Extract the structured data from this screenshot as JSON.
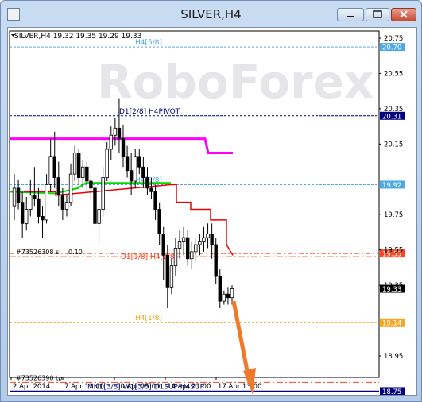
{
  "window": {
    "title": "SILVER,H4",
    "buttons": [
      "minimize",
      "maximize",
      "close"
    ]
  },
  "chart_header": "SILVER,H4  19.32 19.35 19.29 19.33",
  "watermark": "RoboForex",
  "colors": {
    "murrey_resistance": "#4fa9e8",
    "murrey_support": "#f5a623",
    "pivot_magenta": "#ff00ff",
    "green_line": "#00dd00",
    "red_line": "#ee0000",
    "navy_line": "#000080",
    "trade_line": "#ff4422",
    "arrow": "#f07a2a",
    "candles": "#000000",
    "grid_label_dark": "#000000"
  },
  "chart_data": {
    "type": "candlestick",
    "symbol": "SILVER",
    "timeframe": "H4",
    "ylim": [
      18.72,
      20.8
    ],
    "y_ticks": [
      20.75,
      20.55,
      20.35,
      20.15,
      19.75,
      19.55,
      19.35,
      18.95
    ],
    "x_tick_labels": [
      "2 Apr 2014",
      "7 Apr 13:00",
      "10 Apr 05:00",
      "14 Apr 21:00",
      "17 Apr 13:00"
    ],
    "current_price": 19.33,
    "levels": [
      {
        "label": "H4[5/8]",
        "value": 20.7,
        "style": "dashed",
        "color": "#4fa9e8",
        "tag": "20.70"
      },
      {
        "label": "D1[2/8] H4PIVOT",
        "value": 20.31,
        "style": "dashed",
        "color": "#000080",
        "tag": "20.31"
      },
      {
        "label": "H4[3/8]",
        "value": 19.92,
        "style": "dashed",
        "color": "#4fa9e8",
        "tag": "19.92"
      },
      {
        "label": "D1[1/8] H4[2/8]",
        "value": 19.53,
        "style": "dashed",
        "color": "#ff4422",
        "tag": "19.53"
      },
      {
        "label": "H4[1/8]",
        "value": 19.14,
        "style": "dashed",
        "color": "#f5a623",
        "tag": "19.14"
      },
      {
        "label": "MN1[3/8] W1[3/8] D1SUP H4SUP",
        "value": 18.75,
        "style": "solid",
        "color": "#000080",
        "tag": "18.75"
      }
    ],
    "trade_levels": [
      {
        "label": "#73526308 sl",
        "extra": "0.10",
        "value": 19.53
      },
      {
        "label": "#73526390 tp",
        "value": 18.8
      }
    ],
    "candles": [
      [
        19.8,
        19.98,
        19.72,
        19.9
      ],
      [
        19.9,
        19.95,
        19.78,
        19.82
      ],
      [
        19.82,
        19.88,
        19.62,
        19.7
      ],
      [
        19.7,
        19.85,
        19.66,
        19.78
      ],
      [
        19.78,
        19.95,
        19.74,
        19.86
      ],
      [
        19.86,
        20.02,
        19.8,
        19.84
      ],
      [
        19.84,
        19.9,
        19.7,
        19.74
      ],
      [
        19.74,
        19.8,
        19.62,
        19.72
      ],
      [
        19.72,
        19.98,
        19.7,
        19.92
      ],
      [
        19.92,
        20.18,
        19.88,
        20.08
      ],
      [
        20.08,
        20.22,
        19.9,
        19.96
      ],
      [
        19.96,
        20.05,
        19.8,
        19.86
      ],
      [
        19.86,
        19.9,
        19.72,
        19.78
      ],
      [
        19.78,
        19.86,
        19.74,
        19.82
      ],
      [
        19.82,
        20.04,
        19.8,
        19.98
      ],
      [
        19.98,
        20.14,
        19.94,
        20.1
      ],
      [
        20.1,
        20.12,
        19.92,
        19.96
      ],
      [
        19.96,
        20.06,
        19.9,
        20.02
      ],
      [
        20.02,
        20.05,
        19.88,
        19.94
      ],
      [
        19.94,
        19.98,
        19.84,
        19.9
      ],
      [
        19.9,
        19.94,
        19.64,
        19.7
      ],
      [
        19.7,
        19.82,
        19.58,
        19.78
      ],
      [
        19.78,
        20.02,
        19.74,
        19.96
      ],
      [
        19.96,
        20.16,
        19.94,
        20.12
      ],
      [
        20.12,
        20.25,
        20.06,
        20.2
      ],
      [
        20.2,
        20.3,
        20.14,
        20.24
      ],
      [
        20.24,
        20.41,
        20.1,
        20.18
      ],
      [
        20.18,
        20.26,
        20.02,
        20.08
      ],
      [
        20.08,
        20.14,
        19.96,
        20.0
      ],
      [
        20.0,
        20.1,
        19.86,
        19.94
      ],
      [
        19.94,
        20.12,
        19.9,
        20.08
      ],
      [
        20.08,
        20.12,
        19.98,
        20.02
      ],
      [
        20.02,
        20.08,
        19.9,
        19.96
      ],
      [
        19.96,
        20.02,
        19.86,
        19.9
      ],
      [
        19.9,
        19.96,
        19.84,
        19.88
      ],
      [
        19.88,
        19.92,
        19.72,
        19.78
      ],
      [
        19.78,
        19.82,
        19.58,
        19.64
      ],
      [
        19.64,
        19.68,
        19.38,
        19.52
      ],
      [
        19.52,
        19.58,
        19.22,
        19.34
      ],
      [
        19.34,
        19.5,
        19.3,
        19.46
      ],
      [
        19.46,
        19.62,
        19.4,
        19.56
      ],
      [
        19.56,
        19.66,
        19.5,
        19.6
      ],
      [
        19.6,
        19.68,
        19.52,
        19.62
      ],
      [
        19.62,
        19.66,
        19.46,
        19.5
      ],
      [
        19.5,
        19.6,
        19.44,
        19.54
      ],
      [
        19.54,
        19.62,
        19.48,
        19.58
      ],
      [
        19.58,
        19.64,
        19.52,
        19.6
      ],
      [
        19.6,
        19.68,
        19.54,
        19.62
      ],
      [
        19.62,
        19.7,
        19.56,
        19.64
      ],
      [
        19.64,
        19.7,
        19.5,
        19.58
      ],
      [
        19.58,
        19.62,
        19.36,
        19.4
      ],
      [
        19.4,
        19.44,
        19.22,
        19.26
      ],
      [
        19.26,
        19.32,
        19.24,
        19.3
      ],
      [
        19.3,
        19.34,
        19.24,
        19.28
      ],
      [
        19.28,
        19.35,
        19.24,
        19.33
      ]
    ]
  }
}
